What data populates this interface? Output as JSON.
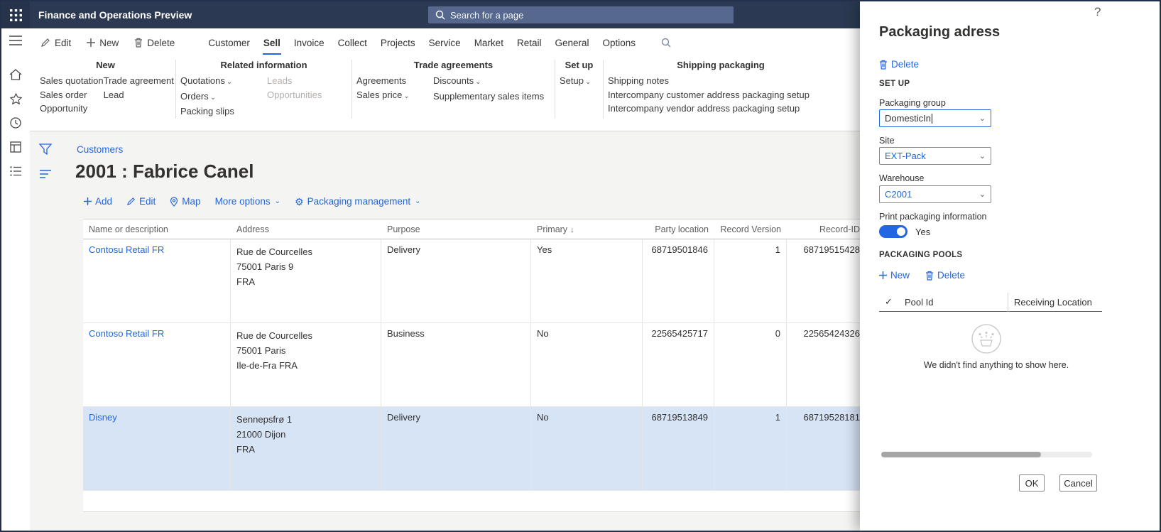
{
  "colors": {
    "accent": "#2266E3",
    "header_bg": "#2B3A52",
    "selected_row": "#D7E4F6",
    "toggle_on": "#2266E3"
  },
  "header": {
    "app_title": "Finance and Operations Preview",
    "search_placeholder": "Search for a page"
  },
  "action_bar": {
    "edit": "Edit",
    "new": "New",
    "delete": "Delete",
    "tabs": [
      "Customer",
      "Sell",
      "Invoice",
      "Collect",
      "Projects",
      "Service",
      "Market",
      "Retail",
      "General",
      "Options"
    ],
    "active_tab": "Sell"
  },
  "ribbon": {
    "groups": [
      {
        "title": "New",
        "cols": [
          {
            "items": [
              {
                "label": "Sales quotation"
              },
              {
                "label": "Sales order"
              },
              {
                "label": "Opportunity"
              }
            ]
          },
          {
            "items": [
              {
                "label": "Trade agreement"
              },
              {
                "label": "Lead"
              }
            ]
          }
        ]
      },
      {
        "title": "Related information",
        "cols": [
          {
            "items": [
              {
                "label": "Quotations",
                "dropdown": true
              },
              {
                "label": "Orders",
                "dropdown": true
              },
              {
                "label": "Packing slips"
              }
            ]
          },
          {
            "items": [
              {
                "label": "Leads",
                "disabled": true
              },
              {
                "label": "Opportunities",
                "disabled": true
              }
            ]
          }
        ]
      },
      {
        "title": "Trade agreements",
        "cols": [
          {
            "items": [
              {
                "label": "Agreements"
              },
              {
                "label": "Sales price",
                "dropdown": true
              }
            ]
          },
          {
            "items": [
              {
                "label": "Discounts",
                "dropdown": true
              },
              {
                "label": "Supplementary sales items"
              }
            ]
          }
        ]
      },
      {
        "title": "Set up",
        "cols": [
          {
            "items": [
              {
                "label": "Setup",
                "dropdown": true
              }
            ]
          }
        ]
      },
      {
        "title": "Shipping packaging",
        "cols": [
          {
            "items": [
              {
                "label": "Shipping notes"
              },
              {
                "label": "Intercompany customer address packaging setup"
              },
              {
                "label": "Intercompany vendor address packaging setup"
              }
            ]
          }
        ]
      }
    ]
  },
  "content": {
    "breadcrumb": "Customers",
    "title": "2001 : Fabrice Canel",
    "toolbar": {
      "add": "Add",
      "edit": "Edit",
      "map": "Map",
      "more": "More options",
      "packaging": "Packaging management"
    },
    "grid": {
      "columns": {
        "name": "Name or description",
        "address": "Address",
        "purpose": "Purpose",
        "primary": "Primary",
        "party": "Party location",
        "version": "Record Version",
        "id": "Record-ID"
      },
      "sort": {
        "column": "Primary",
        "direction": "desc"
      },
      "rows": [
        {
          "name": "Contosu Retail FR",
          "address": [
            "Rue de Courcelles",
            "75001 Paris 9",
            "FRA"
          ],
          "purpose": "Delivery",
          "primary": "Yes",
          "party": "68719501846",
          "version": "1",
          "id": "68719515428",
          "selected": false
        },
        {
          "name": "Contoso Retail FR",
          "address": [
            "Rue de Courcelles",
            "75001 Paris",
            "Ile-de-Fra FRA"
          ],
          "purpose": "Business",
          "primary": "No",
          "party": "22565425717",
          "version": "0",
          "id": "22565424326",
          "selected": false
        },
        {
          "name": "Disney",
          "address": [
            "Sennepsfrø 1",
            "21000 Dijon",
            "FRA"
          ],
          "purpose": "Delivery",
          "primary": "No",
          "party": "68719513849",
          "version": "1",
          "id": "68719528181",
          "selected": true
        }
      ]
    }
  },
  "flyout": {
    "title": "Packaging adress",
    "help": "?",
    "delete_label": "Delete",
    "sections": {
      "setup": "SET UP",
      "pools": "PACKAGING POOLS"
    },
    "fields": {
      "packaging_group": {
        "label": "Packaging group",
        "value": "DomesticIn"
      },
      "site": {
        "label": "Site",
        "value": "EXT-Pack"
      },
      "warehouse": {
        "label": "Warehouse",
        "value": "C2001"
      }
    },
    "toggle": {
      "label": "Print packaging information",
      "state": "Yes"
    },
    "pools": {
      "new_label": "New",
      "delete_label": "Delete",
      "columns": {
        "pool_id": "Pool Id",
        "receiving": "Receiving Location"
      },
      "empty_text": "We didn't find anything to show here."
    },
    "ok": "OK",
    "cancel": "Cancel"
  }
}
